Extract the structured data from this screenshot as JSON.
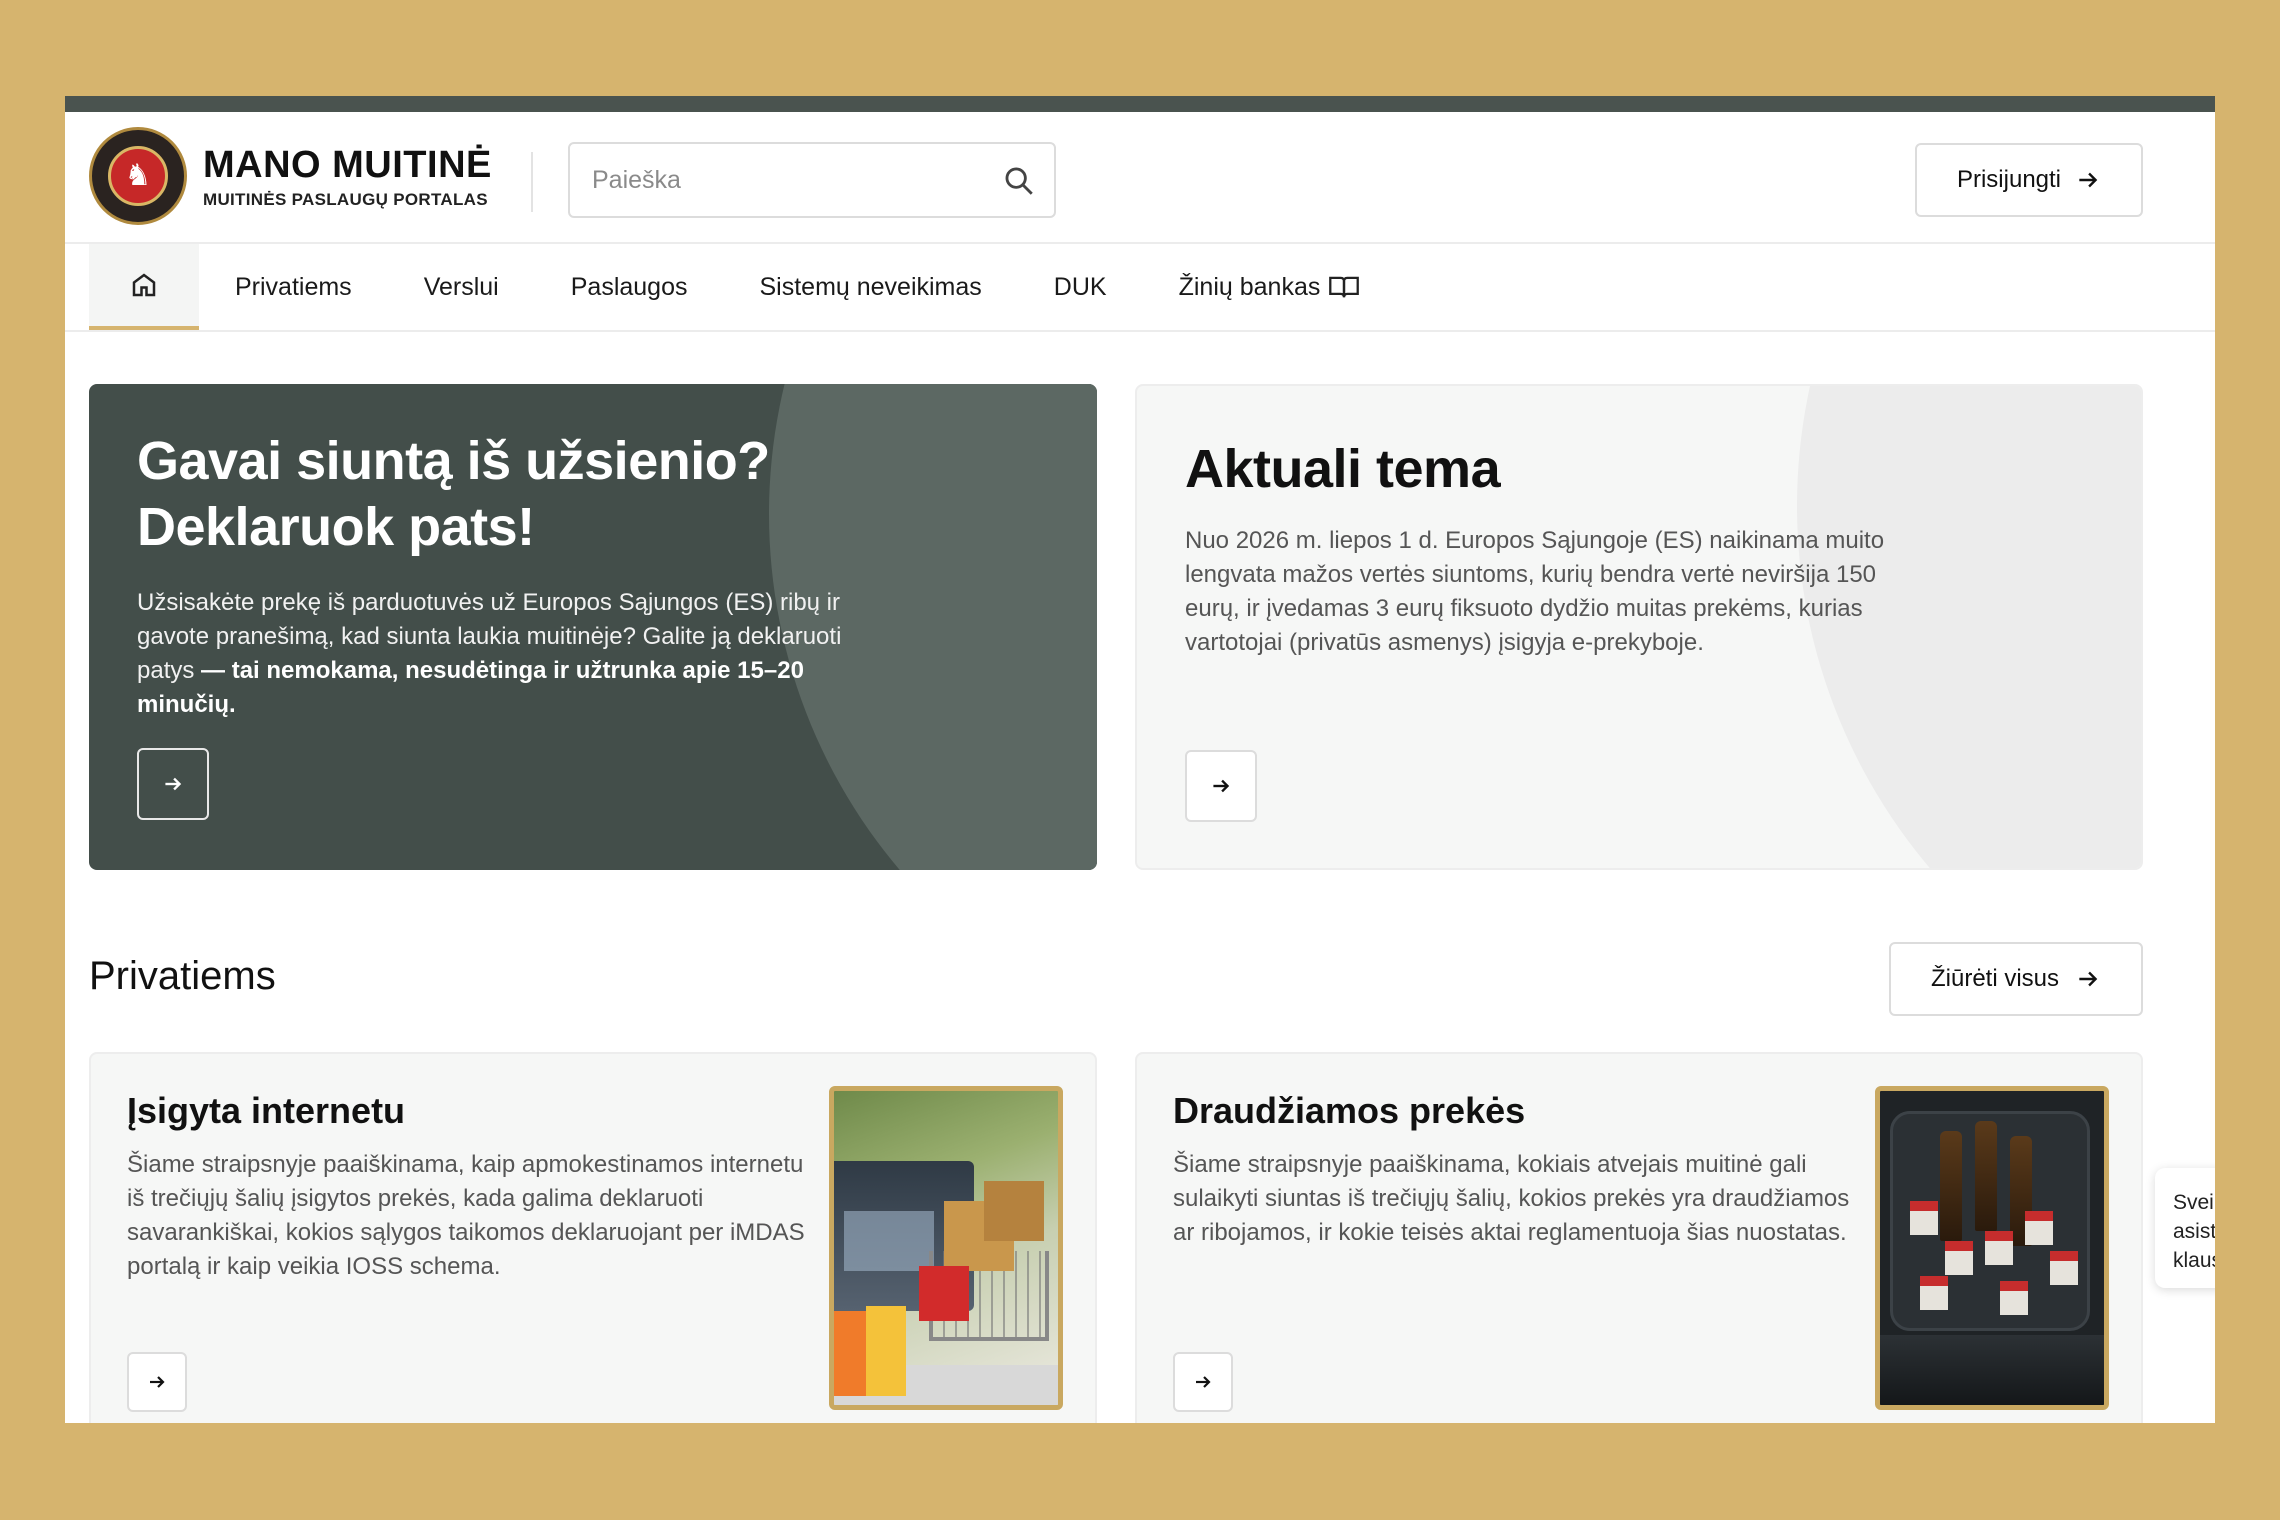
{
  "brand": {
    "title": "MANO MUITINĖ",
    "subtitle": "MUITINĖS PASLAUGŲ PORTALAS",
    "logo_icon": "customs-seal-icon"
  },
  "search": {
    "placeholder": "Paieška"
  },
  "login": {
    "label": "Prisijungti"
  },
  "nav": {
    "home_icon": "home-icon",
    "items": [
      {
        "label": "Privatiems"
      },
      {
        "label": "Verslui"
      },
      {
        "label": "Paslaugos"
      },
      {
        "label": "Sistemų neveikimas"
      },
      {
        "label": "DUK"
      },
      {
        "label": "Žinių bankas"
      }
    ]
  },
  "hero": {
    "title": "Gavai siuntą iš užsienio? Deklaruok pats!",
    "text_plain": "Užsisakėte prekę iš parduotuvės už Europos Sąjungos (ES)  ribų ir gavote pranešimą, kad siunta laukia muitinėje? Galite ją deklaruoti patys",
    "text_bold": " — tai nemokama, nesudėtinga ir užtrunka apie 15–20 minučių."
  },
  "topic": {
    "title": "Aktuali tema",
    "text": "Nuo 2026 m. liepos 1 d. Europos Sąjungoje (ES) naikinama muito lengvata mažos vertės siuntoms, kurių bendra vertė neviršija 150 eurų,  ir įvedamas 3 eurų fiksuoto dydžio muitas prekėms, kurias vartotojai (privatūs asmenys) įsigyja e-prekyboje."
  },
  "section": {
    "title": "Privatiems",
    "see_all": "Žiūrėti visus"
  },
  "cards": [
    {
      "title": "Įsigyta internetu",
      "text": "Šiame straipsnyje paaiškinama, kaip apmokestinamos internetu iš trečiųjų šalių įsigytos prekės, kada galima deklaruoti savarankiškai, kokios sąlygos taikomos deklaruojant per iMDAS portalą ir kaip veikia IOSS schema."
    },
    {
      "title": "Draudžiamos prekės",
      "text": "Šiame straipsnyje paaiškinama, kokiais atvejais muitinė gali sulaikyti siuntas iš trečiųjų šalių, kokios prekės yra draudžiamos ar ribojamos, ir kokie teisės aktai reglamentuoja šias nuostatas."
    }
  ],
  "chat": {
    "lines": [
      "Sveiki, es",
      "asistentas",
      "klausimą."
    ]
  },
  "colors": {
    "accent": "#d6b46e",
    "hero_dark": "#434e4a",
    "topbar": "#4a534f"
  }
}
